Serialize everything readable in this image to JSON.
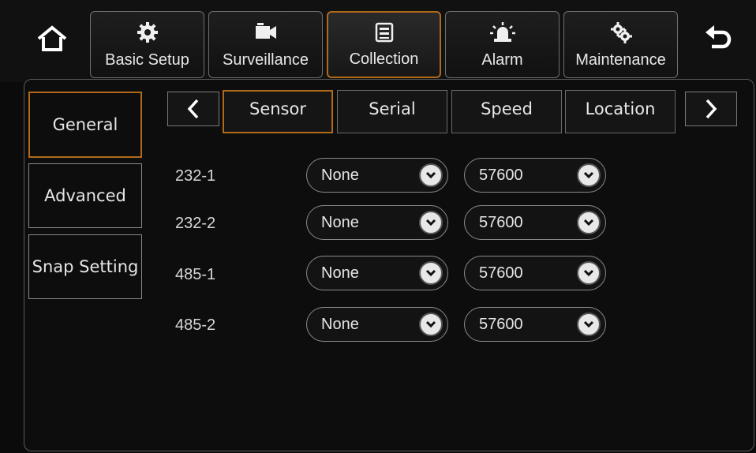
{
  "header": {
    "tabs": [
      {
        "label": "Basic Setup",
        "icon": "gear-icon"
      },
      {
        "label": "Surveillance",
        "icon": "camera-icon"
      },
      {
        "label": "Collection",
        "icon": "collection-icon"
      },
      {
        "label": "Alarm",
        "icon": "alarm-icon"
      },
      {
        "label": "Maintenance",
        "icon": "maintenance-icon"
      }
    ],
    "active_tab": "Collection"
  },
  "sidebar": {
    "items": [
      {
        "label": "General"
      },
      {
        "label": "Advanced"
      },
      {
        "label": "Snap Setting"
      }
    ],
    "active_item": "General"
  },
  "subtabs": {
    "items": [
      {
        "label": "Sensor"
      },
      {
        "label": "Serial"
      },
      {
        "label": "Speed"
      },
      {
        "label": "Location"
      }
    ],
    "active": "Sensor"
  },
  "rows": [
    {
      "label": "232-1",
      "device": "None",
      "baud": "57600"
    },
    {
      "label": "232-2",
      "device": "None",
      "baud": "57600"
    },
    {
      "label": "485-1",
      "device": "None",
      "baud": "57600"
    },
    {
      "label": "485-2",
      "device": "None",
      "baud": "57600"
    }
  ],
  "colors": {
    "accent": "#b06a1a",
    "background": "#0b0b0b"
  }
}
